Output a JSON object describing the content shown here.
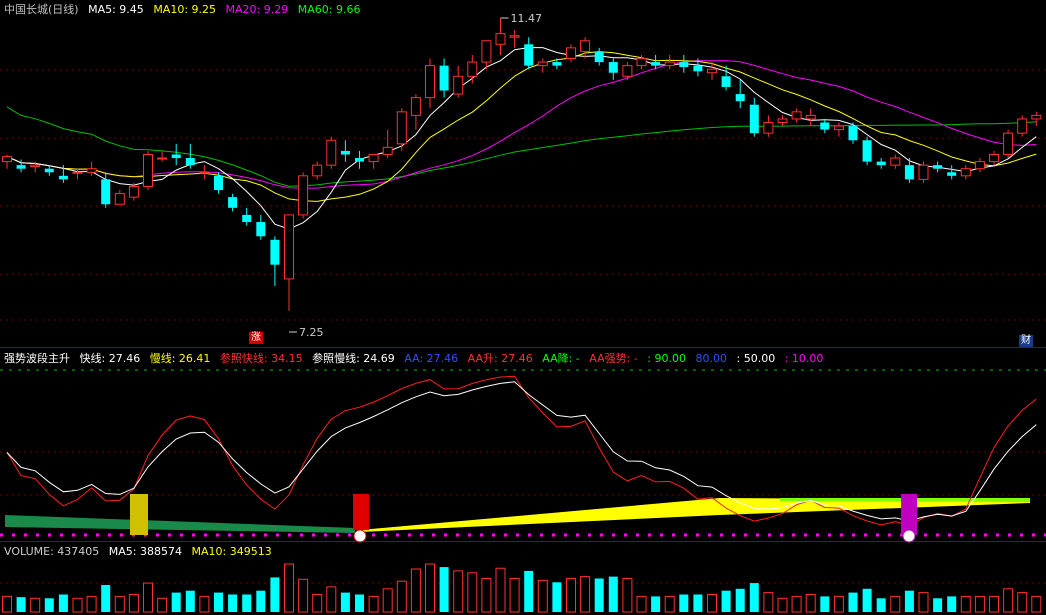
{
  "header": {
    "stock_label": "中国长城(日线)",
    "ma5": "MA5: 9.45",
    "ma10": "MA10: 9.25",
    "ma20": "MA20: 9.29",
    "ma60": "MA60: 9.66",
    "colors": {
      "stock": "#c0c0c0",
      "ma5": "#ffffff",
      "ma10": "#ffff00",
      "ma20": "#ff00ff",
      "ma60": "#00ff00"
    }
  },
  "indicator": {
    "name": "强势波段主升",
    "fast": "快线: 27.46",
    "slow": "慢线: 26.41",
    "ref_fast": "参照快线: 34.15",
    "ref_slow": "参照慢线: 24.69",
    "aa": "AA: 27.46",
    "aa_up": "AA升: 27.46",
    "aa_down": "AA降: -",
    "aa_strong": "AA强势: -",
    "v90": ": 90.00",
    "v80": "80.00",
    "v50": ": 50.00",
    "v10": ": 10.00"
  },
  "volume": {
    "label": "VOLUME: 437405",
    "ma5": "MA5: 388574",
    "ma10": "MA10: 349513"
  },
  "annotations": {
    "high": "11.47",
    "low": "7.25",
    "zhang": "涨",
    "cai": "财"
  },
  "chart_data": {
    "type": "candlestick",
    "price_range": [
      7.25,
      11.47
    ],
    "candles": [
      [
        9.45,
        9.55,
        9.35,
        9.52
      ],
      [
        9.4,
        9.48,
        9.3,
        9.35
      ],
      [
        9.38,
        9.45,
        9.3,
        9.4
      ],
      [
        9.35,
        9.4,
        9.25,
        9.3
      ],
      [
        9.25,
        9.4,
        9.15,
        9.2
      ],
      [
        9.3,
        9.35,
        9.2,
        9.3
      ],
      [
        9.3,
        9.45,
        9.25,
        9.35
      ],
      [
        9.2,
        9.3,
        8.8,
        8.85
      ],
      [
        8.85,
        9.05,
        8.85,
        9.0
      ],
      [
        8.95,
        9.15,
        8.9,
        9.1
      ],
      [
        9.1,
        9.6,
        9.05,
        9.55
      ],
      [
        9.5,
        9.6,
        9.45,
        9.5
      ],
      [
        9.55,
        9.7,
        9.4,
        9.5
      ],
      [
        9.5,
        9.7,
        9.35,
        9.4
      ],
      [
        9.3,
        9.4,
        9.2,
        9.3
      ],
      [
        9.25,
        9.3,
        9.0,
        9.05
      ],
      [
        8.95,
        9.0,
        8.75,
        8.8
      ],
      [
        8.7,
        8.8,
        8.55,
        8.6
      ],
      [
        8.6,
        8.7,
        8.35,
        8.4
      ],
      [
        8.35,
        8.4,
        7.7,
        8.0
      ],
      [
        7.8,
        8.7,
        7.35,
        8.7
      ],
      [
        8.7,
        9.3,
        8.65,
        9.25
      ],
      [
        9.25,
        9.45,
        9.2,
        9.4
      ],
      [
        9.4,
        9.8,
        9.35,
        9.75
      ],
      [
        9.6,
        9.75,
        9.45,
        9.55
      ],
      [
        9.5,
        9.6,
        9.35,
        9.45
      ],
      [
        9.45,
        9.55,
        9.35,
        9.55
      ],
      [
        9.55,
        9.9,
        9.5,
        9.65
      ],
      [
        9.7,
        10.2,
        9.6,
        10.15
      ],
      [
        10.1,
        10.4,
        9.9,
        10.35
      ],
      [
        10.35,
        10.9,
        10.2,
        10.8
      ],
      [
        10.8,
        10.9,
        10.35,
        10.45
      ],
      [
        10.4,
        10.8,
        10.35,
        10.65
      ],
      [
        10.65,
        10.95,
        10.55,
        10.85
      ],
      [
        10.85,
        11.0,
        10.75,
        11.15
      ],
      [
        11.1,
        11.47,
        10.95,
        11.25
      ],
      [
        11.2,
        11.3,
        11.05,
        11.22
      ],
      [
        11.1,
        11.2,
        10.75,
        10.8
      ],
      [
        10.8,
        10.9,
        10.7,
        10.85
      ],
      [
        10.85,
        10.9,
        10.75,
        10.8
      ],
      [
        10.9,
        11.1,
        10.85,
        11.05
      ],
      [
        11.0,
        11.2,
        10.9,
        11.15
      ],
      [
        11.0,
        11.05,
        10.8,
        10.85
      ],
      [
        10.85,
        10.9,
        10.6,
        10.7
      ],
      [
        10.65,
        10.85,
        10.6,
        10.8
      ],
      [
        10.8,
        10.95,
        10.75,
        10.9
      ],
      [
        10.85,
        10.95,
        10.75,
        10.8
      ],
      [
        10.8,
        10.95,
        10.75,
        10.85
      ],
      [
        10.85,
        10.95,
        10.7,
        10.78
      ],
      [
        10.8,
        10.9,
        10.65,
        10.72
      ],
      [
        10.7,
        10.85,
        10.6,
        10.75
      ],
      [
        10.65,
        10.8,
        10.45,
        10.5
      ],
      [
        10.4,
        10.6,
        10.2,
        10.3
      ],
      [
        10.25,
        10.35,
        9.8,
        9.85
      ],
      [
        9.85,
        10.1,
        9.8,
        10.0
      ],
      [
        10.0,
        10.1,
        9.95,
        10.05
      ],
      [
        10.05,
        10.2,
        10.0,
        10.15
      ],
      [
        10.05,
        10.2,
        9.95,
        10.1
      ],
      [
        10.0,
        10.05,
        9.85,
        9.9
      ],
      [
        9.9,
        10.0,
        9.8,
        9.95
      ],
      [
        9.95,
        10.0,
        9.7,
        9.75
      ],
      [
        9.75,
        9.8,
        9.4,
        9.45
      ],
      [
        9.45,
        9.5,
        9.35,
        9.4
      ],
      [
        9.4,
        9.55,
        9.35,
        9.5
      ],
      [
        9.4,
        9.5,
        9.15,
        9.2
      ],
      [
        9.2,
        9.45,
        9.15,
        9.4
      ],
      [
        9.4,
        9.45,
        9.3,
        9.35
      ],
      [
        9.3,
        9.4,
        9.2,
        9.25
      ],
      [
        9.25,
        9.4,
        9.2,
        9.35
      ],
      [
        9.35,
        9.5,
        9.3,
        9.45
      ],
      [
        9.45,
        9.6,
        9.4,
        9.55
      ],
      [
        9.55,
        9.9,
        9.5,
        9.85
      ],
      [
        9.85,
        10.1,
        9.8,
        10.05
      ],
      [
        10.05,
        10.15,
        9.95,
        10.1
      ]
    ]
  }
}
